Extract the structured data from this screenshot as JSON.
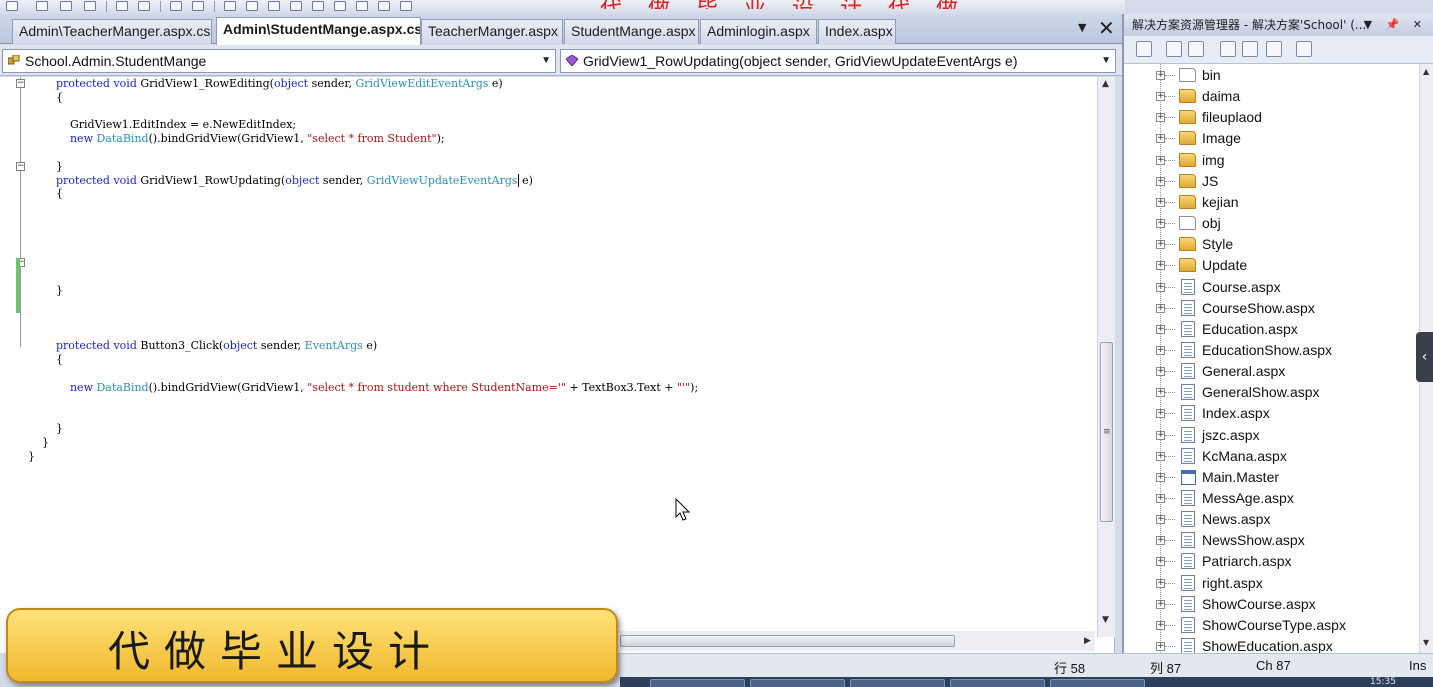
{
  "tabs": [
    {
      "label": "Admin\\TeacherManger.aspx.cs",
      "active": false
    },
    {
      "label": "Admin\\StudentMange.aspx.cs",
      "active": true
    },
    {
      "label": "TeacherManger.aspx",
      "active": false
    },
    {
      "label": "StudentMange.aspx",
      "active": false
    },
    {
      "label": "Adminlogin.aspx",
      "active": false
    },
    {
      "label": "Index.aspx",
      "active": false
    }
  ],
  "tab_controls": {
    "dropdown": "▼",
    "close": "✕"
  },
  "navbar": {
    "class_combo": "School.Admin.StudentMange",
    "member_combo": "GridView1_RowUpdating(object sender, GridViewUpdateEventArgs e)"
  },
  "code": {
    "l1_kw": "protected void",
    "l1_name": " GridView1_RowEditing(",
    "l1_kw2": "object",
    "l1_mid": " sender, ",
    "l1_type": "GridViewEditEventArgs",
    "l1_end": " e)",
    "l2": "{",
    "l3": "GridView1.EditIndex = e.NewEditIndex;",
    "l4_kw": "new",
    "l4_type": "DataBind",
    "l4_mid": "().bindGridView(GridView1, ",
    "l4_str": "\"select * from Student\"",
    "l4_end": ");",
    "l5": "}",
    "l6_kw": "protected void",
    "l6_name": " GridView1_RowUpdating(",
    "l6_kw2": "object",
    "l6_mid": " sender, ",
    "l6_type": "GridViewUpdateEventArgs",
    "l6_end": " e)",
    "l7": "{",
    "l8": "}",
    "l9_kw": "protected void",
    "l9_name": " Button3_Click(",
    "l9_kw2": "object",
    "l9_mid": " sender, ",
    "l9_type": "EventArgs",
    "l9_end": " e)",
    "l10": "{",
    "l11_kw": "new",
    "l11_type": "DataBind",
    "l11_mid": "().bindGridView(GridView1, ",
    "l11_str": "\"select * from student where StudentName='\"",
    "l11_mid2": " + TextBox3.Text + ",
    "l11_str2": "\"'\"",
    "l11_end": ");",
    "l12": "}",
    "l13": "}",
    "l14": "}"
  },
  "banner_text": "代做毕业设计",
  "statusbar": {
    "line": "行 58",
    "col": "列 87",
    "ch": "Ch 87",
    "mode": "Ins"
  },
  "taskbar_clock": "15:35",
  "solution_explorer": {
    "title": "解决方案资源管理器 - 解决方案'School' (...",
    "title_controls": "▼ 📌 ✕",
    "items": [
      {
        "label": "bin",
        "icon": "folder-empty-icon"
      },
      {
        "label": "daima",
        "icon": "folder-icon"
      },
      {
        "label": "fileuplaod",
        "icon": "folder-icon"
      },
      {
        "label": "Image",
        "icon": "folder-icon"
      },
      {
        "label": "img",
        "icon": "folder-icon"
      },
      {
        "label": "JS",
        "icon": "folder-icon"
      },
      {
        "label": "kejian",
        "icon": "folder-icon"
      },
      {
        "label": "obj",
        "icon": "folder-empty-icon"
      },
      {
        "label": "Style",
        "icon": "folder-icon"
      },
      {
        "label": "Update",
        "icon": "folder-icon"
      },
      {
        "label": "Course.aspx",
        "icon": "aspx-page-icon"
      },
      {
        "label": "CourseShow.aspx",
        "icon": "aspx-page-icon"
      },
      {
        "label": "Education.aspx",
        "icon": "aspx-page-icon"
      },
      {
        "label": "EducationShow.aspx",
        "icon": "aspx-page-icon"
      },
      {
        "label": "General.aspx",
        "icon": "aspx-page-icon"
      },
      {
        "label": "GeneralShow.aspx",
        "icon": "aspx-page-icon"
      },
      {
        "label": "Index.aspx",
        "icon": "aspx-page-icon"
      },
      {
        "label": "jszc.aspx",
        "icon": "aspx-page-icon"
      },
      {
        "label": "KcMana.aspx",
        "icon": "aspx-page-icon"
      },
      {
        "label": "Main.Master",
        "icon": "master-page-icon"
      },
      {
        "label": "MessAge.aspx",
        "icon": "aspx-page-icon"
      },
      {
        "label": "News.aspx",
        "icon": "aspx-page-icon"
      },
      {
        "label": "NewsShow.aspx",
        "icon": "aspx-page-icon"
      },
      {
        "label": "Patriarch.aspx",
        "icon": "aspx-page-icon"
      },
      {
        "label": "right.aspx",
        "icon": "aspx-page-icon"
      },
      {
        "label": "ShowCourse.aspx",
        "icon": "aspx-page-icon"
      },
      {
        "label": "ShowCourseType.aspx",
        "icon": "aspx-page-icon"
      },
      {
        "label": "ShowEducation.aspx",
        "icon": "aspx-page-icon"
      }
    ]
  },
  "colors": {
    "keyword": "#1a22c8",
    "type": "#2b91af",
    "string": "#a31515",
    "banner": "#f0b82c"
  }
}
